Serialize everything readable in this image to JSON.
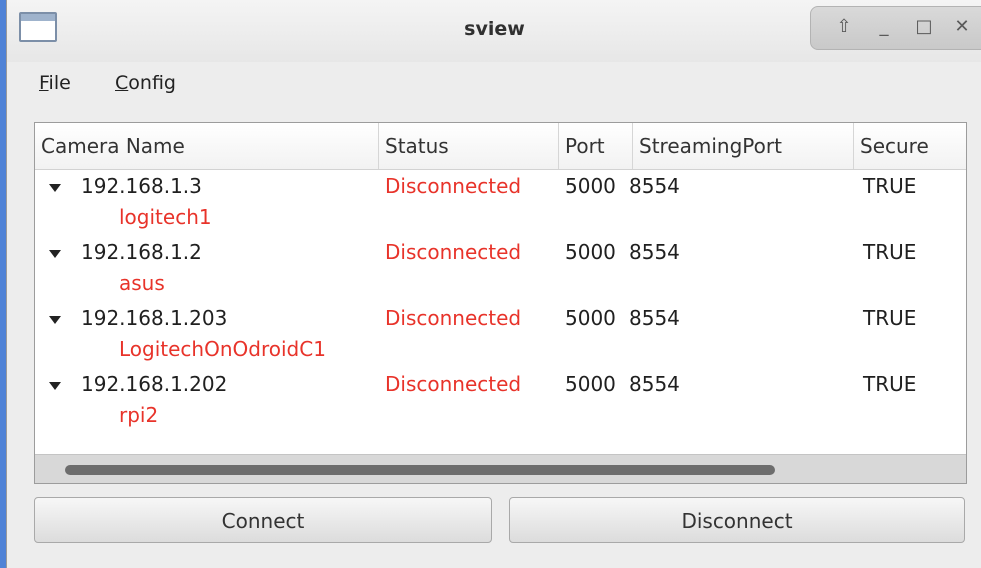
{
  "window": {
    "title": "sview",
    "controls": [
      "⇧",
      "_",
      "□",
      "✕"
    ]
  },
  "menubar": {
    "items": [
      {
        "mnemonic": "F",
        "rest": "ile"
      },
      {
        "mnemonic": "C",
        "rest": "onfig"
      }
    ]
  },
  "tree": {
    "columns": [
      "Camera Name",
      "Status",
      "Port",
      "StreamingPort",
      "Secure"
    ],
    "rows": [
      {
        "ip": "192.168.1.3",
        "status": "Disconnected",
        "port": "5000",
        "streaming_port": "8554",
        "secure": "TRUE",
        "child": "logitech1"
      },
      {
        "ip": "192.168.1.2",
        "status": "Disconnected",
        "port": "5000",
        "streaming_port": "8554",
        "secure": "TRUE",
        "child": "asus"
      },
      {
        "ip": "192.168.1.203",
        "status": "Disconnected",
        "port": "5000",
        "streaming_port": "8554",
        "secure": "TRUE",
        "child": "LogitechOnOdroidC1"
      },
      {
        "ip": "192.168.1.202",
        "status": "Disconnected",
        "port": "5000",
        "streaming_port": "8554",
        "secure": "TRUE",
        "child": "rpi2"
      }
    ]
  },
  "buttons": {
    "connect": "Connect",
    "disconnect": "Disconnect"
  },
  "colors": {
    "disconnected": "#e8332a",
    "desktop": "#4f82d6"
  },
  "icons": {
    "app": "window-icon",
    "expander": "triangle-down-icon"
  }
}
